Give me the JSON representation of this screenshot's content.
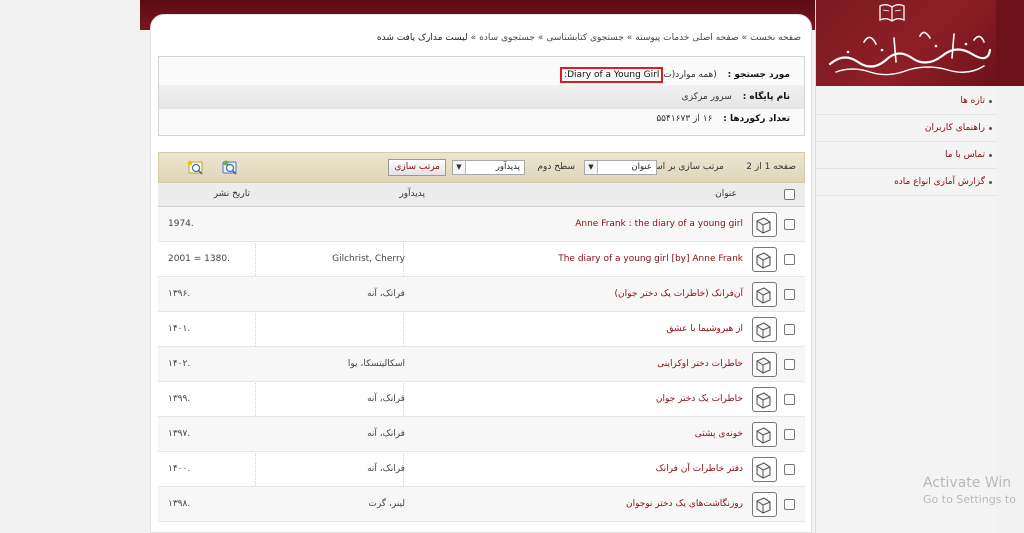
{
  "breadcrumb": {
    "items": [
      "صفحه نخست",
      "صفحه اصلی خدمات پیوسته",
      "جستجوی کتابشناسی",
      "جستجوی ساده"
    ],
    "current": "لیست مدارک یافت شده",
    "separator": "»"
  },
  "info": {
    "query_label": "مورد جستجو :",
    "query_prefix": "(همه موارد(ت",
    "query_value": ":Diary of a Young Girl",
    "db_label": "نام پایگاه :",
    "db_value": "سرور مرکزی",
    "count_label": "تعداد رکوردها :",
    "count_value": "۱۶ از ۵۵۴۱۶۷۳"
  },
  "toolbar": {
    "page_label": "صفحه 1 از 2",
    "sort_by_label": "مرتب سازی بر اساس",
    "sort_by_value": "عنوان",
    "level2_label": "سطح دوم",
    "level2_value": "پدیدآور",
    "sort_button": "مرتب سازی",
    "icons": [
      "print-preview-icon",
      "export-icon"
    ]
  },
  "table": {
    "headers": {
      "title": "عنوان",
      "author": "پدیدآور",
      "date": "تاریخ نشر"
    },
    "rows": [
      {
        "title": "Anne Frank : the diary of a young girl",
        "author": "",
        "date": "1974."
      },
      {
        "title": "The diary of a young girl [by] Anne Frank",
        "author": "Gilchrist, Cherry",
        "date": "2001 = 1380."
      },
      {
        "title": "آن‌فرانک (خاطرات یک دختر جوان)",
        "author": "فرانک، آنه",
        "date": "۱۳۹۶."
      },
      {
        "title": "از هیروشیما با عشق",
        "author": "",
        "date": "۱۴۰۱."
      },
      {
        "title": "خاطرات دختر اوکراینی",
        "author": "اسکالیتسکا، یوا",
        "date": "۱۴۰۲."
      },
      {
        "title": "خاطرات یک دختر جوان",
        "author": "فرانک، آنه",
        "date": "۱۳۹۹."
      },
      {
        "title": "خونه‌ی پشتی",
        "author": "فرانک، آنه",
        "date": "۱۳۹۷."
      },
      {
        "title": "دفتر خاطرات آن فرانک",
        "author": "فرانک، آنه",
        "date": "۱۴۰۰."
      },
      {
        "title": "روزنگاشت‌های یک دختر نوجوان",
        "author": "لینر، گرت",
        "date": "۱۳۹۸."
      }
    ]
  },
  "sidebar": {
    "items": [
      "تازه ها",
      "راهنمای کاربران",
      "تماس با ما",
      "گزارش آماری انواع ماده"
    ]
  },
  "watermark": {
    "line1": "Activate Win",
    "line2": "Go to Settings to"
  },
  "colors": {
    "brand": "#8b0d14",
    "highlight": "#e01b24",
    "toolbar": "#dfd6b8"
  }
}
